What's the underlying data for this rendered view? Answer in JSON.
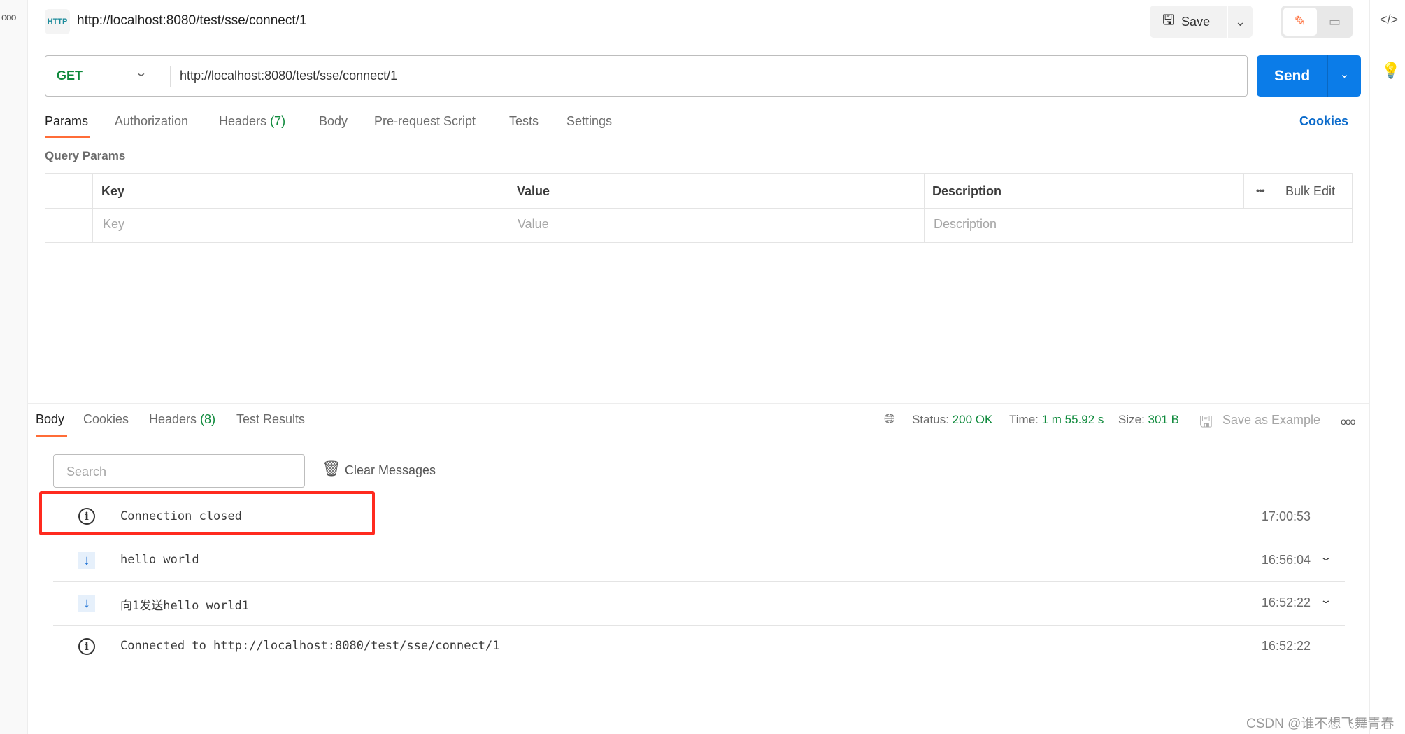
{
  "request": {
    "title": "http://localhost:8080/test/sse/connect/1",
    "method": "GET",
    "url": "http://localhost:8080/test/sse/connect/1",
    "save_label": "Save",
    "send_label": "Send",
    "cookies_label": "Cookies",
    "tabs": [
      {
        "label": "Params",
        "active": true
      },
      {
        "label": "Authorization"
      },
      {
        "label": "Headers",
        "count": "(7)"
      },
      {
        "label": "Body"
      },
      {
        "label": "Pre-request Script"
      },
      {
        "label": "Tests"
      },
      {
        "label": "Settings"
      }
    ],
    "query_params_title": "Query Params",
    "table": {
      "headers": [
        "Key",
        "Value",
        "Description"
      ],
      "bulk_edit": "Bulk Edit",
      "placeholders": [
        "Key",
        "Value",
        "Description"
      ]
    }
  },
  "response": {
    "tabs": [
      {
        "label": "Body",
        "active": true
      },
      {
        "label": "Cookies"
      },
      {
        "label": "Headers",
        "count": "(8)"
      },
      {
        "label": "Test Results"
      }
    ],
    "status_label": "Status:",
    "status_value": "200 OK",
    "time_label": "Time:",
    "time_value": "1 m 55.92 s",
    "size_label": "Size:",
    "size_value": "301 B",
    "save_example": "Save as Example",
    "search_placeholder": "Search",
    "clear_messages": "Clear Messages",
    "messages": [
      {
        "icon": "info-icon",
        "text": "Connection closed",
        "time": "17:00:53",
        "highlighted": true
      },
      {
        "icon": "arrow-down-icon",
        "text": "hello world",
        "time": "16:56:04",
        "expandable": true
      },
      {
        "icon": "arrow-down-icon",
        "text": "向1发送hello world1",
        "time": "16:52:22",
        "expandable": true
      },
      {
        "icon": "info-icon",
        "text": "Connected to http://localhost:8080/test/sse/connect/1",
        "time": "16:52:22"
      }
    ]
  },
  "colors": {
    "accent": "#ff6c37",
    "send": "#0b7ce8",
    "success": "#0f8a3c",
    "highlight_box": "#ff2a1f"
  },
  "watermark": "CSDN @谁不想飞舞青春"
}
